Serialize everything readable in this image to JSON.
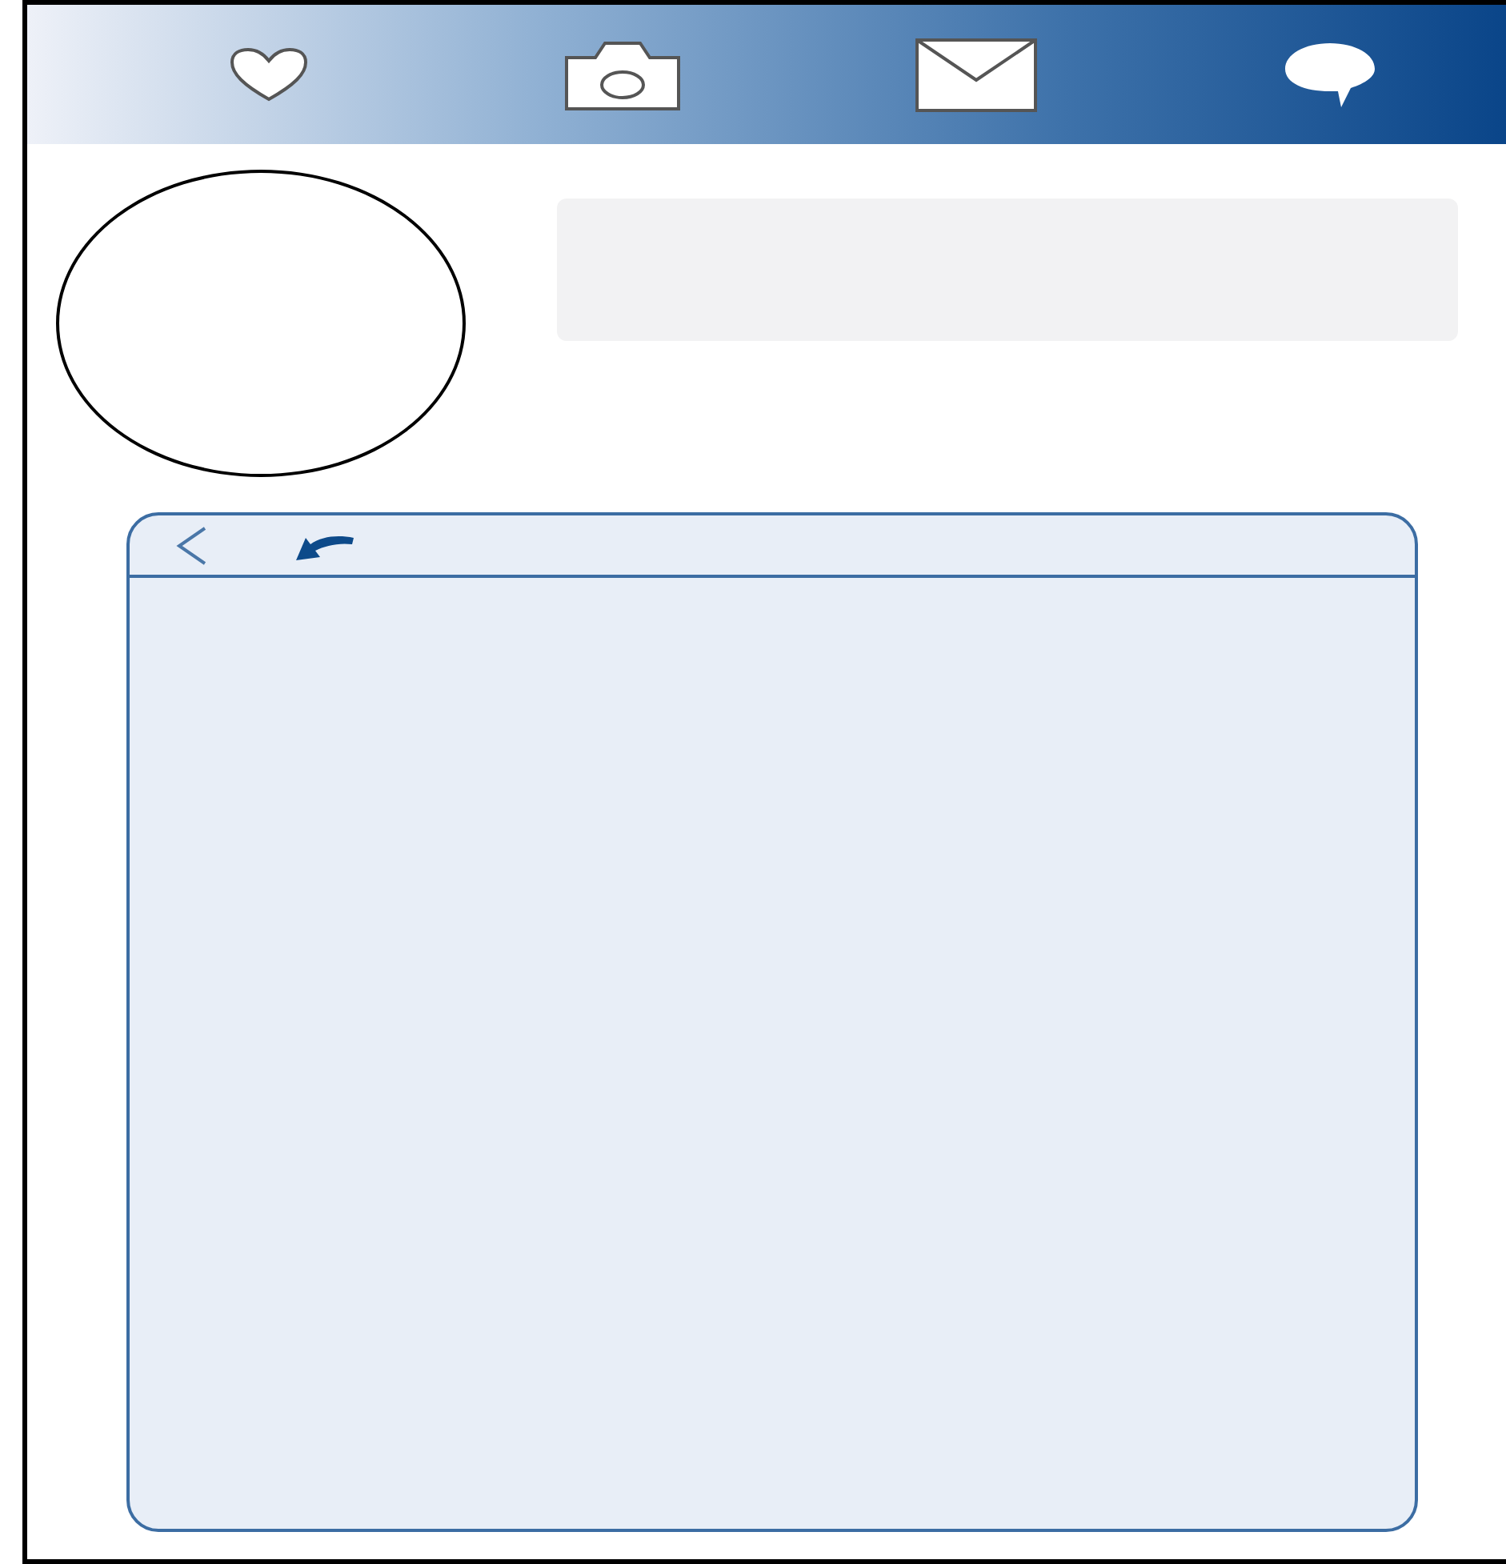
{
  "top_bar": {
    "icons": [
      {
        "kind": "heart"
      },
      {
        "kind": "camera"
      },
      {
        "kind": "mail"
      },
      {
        "kind": "chat"
      }
    ]
  },
  "post_panel": {
    "toolbar": [
      {
        "kind": "back"
      },
      {
        "kind": "reply"
      }
    ]
  }
}
